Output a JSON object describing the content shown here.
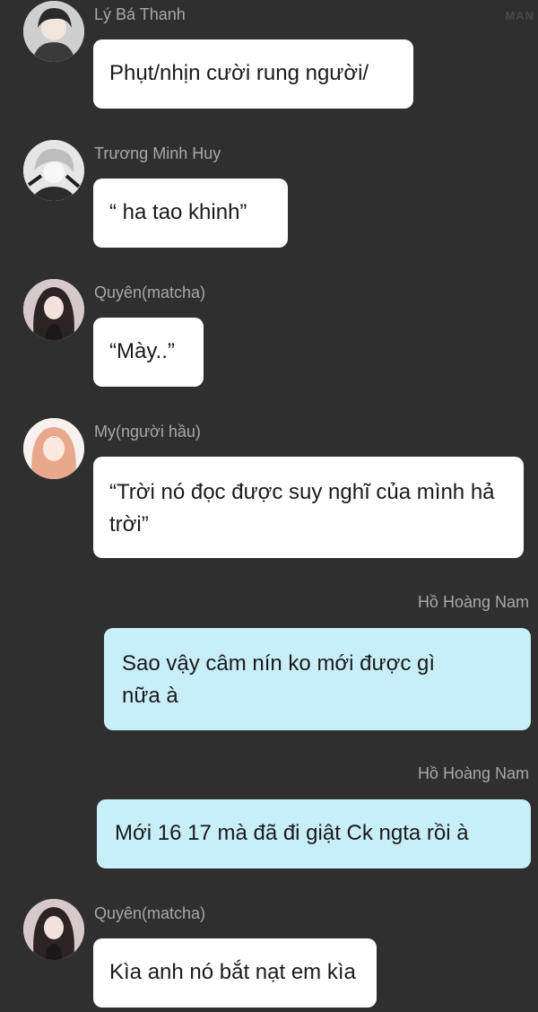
{
  "watermark": "MAN",
  "messages": [
    {
      "sender": "Lý Bá Thanh",
      "text": "Phụt/nhịn cười rung người/",
      "avatar": "anime-boy-dark-hair"
    },
    {
      "sender": "Trương Minh Huy",
      "text": "“ ha tao khinh”",
      "avatar": "anime-boy-white-hair"
    },
    {
      "sender": "Quyên(matcha)",
      "text": "“Mày..”",
      "avatar": "anime-girl-dark-hair"
    },
    {
      "sender": "My(người hầu)",
      "text": "“Trời nó đọc được suy nghĩ của mình hả trời”",
      "avatar": "anime-girl-pink-hair"
    },
    {
      "sender": "Hồ Hoàng Nam",
      "text": "Sao vậy câm nín ko mới được gì nữa à"
    },
    {
      "sender": "Hồ Hoàng Nam",
      "text": "Mới 16 17 mà đã đi giật Ck ngta rồi à"
    },
    {
      "sender": "Quyên(matcha)",
      "text": "Kìa anh nó bắt nạt em kìa",
      "avatar": "anime-girl-dark-hair"
    }
  ],
  "colors": {
    "background": "#2f2f2f",
    "bubble_incoming": "#ffffff",
    "bubble_outgoing": "#c8eefa",
    "sender_name": "#a8a8a8"
  }
}
